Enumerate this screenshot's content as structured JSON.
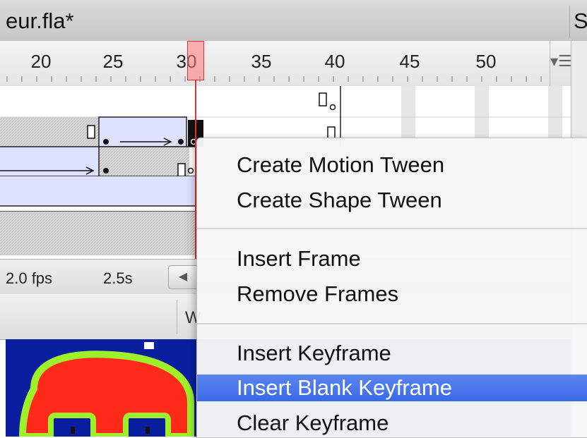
{
  "window": {
    "document_title": "eur.fla*",
    "right_tab_title": "Sp"
  },
  "ruler": {
    "labels": [
      "20",
      "25",
      "30",
      "35",
      "40",
      "45",
      "50"
    ],
    "menu_icon": "panel-menu-icon",
    "current_frame": 30
  },
  "statusbar": {
    "fps": "2.0 fps",
    "elapsed": "2.5s",
    "scroll_left_icon": "triangle-left-icon"
  },
  "editbar": {
    "partial_text": "W"
  },
  "context_menu": {
    "groups": [
      [
        "Create Motion Tween",
        "Create Shape Tween"
      ],
      [
        "Insert Frame",
        "Remove Frames"
      ],
      [
        "Insert Keyframe",
        "Insert Blank Keyframe",
        "Clear Keyframe"
      ]
    ],
    "highlighted": "Insert Blank Keyframe"
  },
  "colors": {
    "playhead": "#e8322a",
    "menu_highlight": "#3b6ae6",
    "tween_fill": "#dfe2ff",
    "stage_bg": "#0a1fa0"
  }
}
